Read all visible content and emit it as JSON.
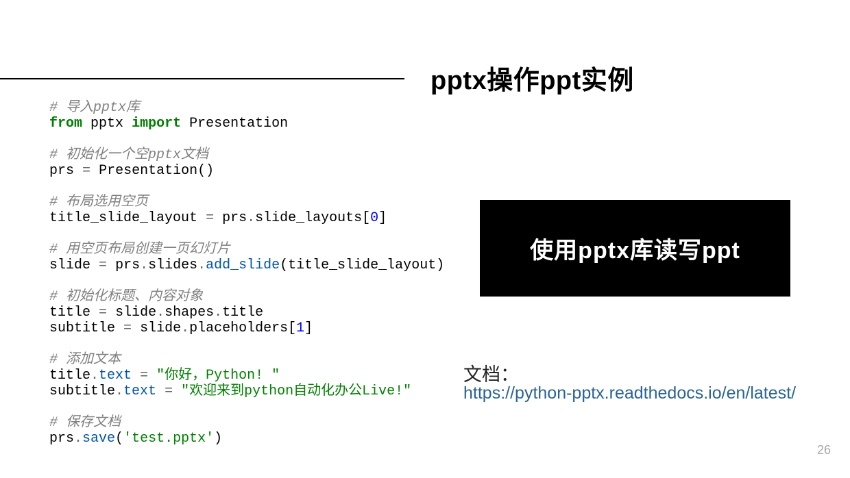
{
  "slide": {
    "title": "pptx操作ppt实例",
    "page_number": "26"
  },
  "code": {
    "c1": "# 导入pptx库",
    "l1a": "from",
    "l1b": "pptx",
    "l1c": "import",
    "l1d": "Presentation",
    "c2": "# 初始化一个空pptx文档",
    "l2a": "prs",
    "l2b": "=",
    "l2c": "Presentation()",
    "c3": "# 布局选用空页",
    "l3a": "title_slide_layout",
    "l3b": "=",
    "l3c": "prs",
    "l3d": ".",
    "l3e": "slide_layouts[",
    "l3f": "0",
    "l3g": "]",
    "c4": "# 用空页布局创建一页幻灯片",
    "l4a": "slide",
    "l4b": "=",
    "l4c": "prs",
    "l4d": ".",
    "l4e": "slides",
    "l4f": ".",
    "l4g": "add_slide",
    "l4h": "(title_slide_layout)",
    "c5": "# 初始化标题、内容对象",
    "l5a": "title",
    "l5b": "=",
    "l5c": "slide",
    "l5d": ".",
    "l5e": "shapes",
    "l5f": ".",
    "l5g": "title",
    "l6a": "subtitle",
    "l6b": "=",
    "l6c": "slide",
    "l6d": ".",
    "l6e": "placeholders[",
    "l6f": "1",
    "l6g": "]",
    "c6": "# 添加文本",
    "l7a": "title",
    "l7b": ".",
    "l7c": "text",
    "l7d": "=",
    "l7e": "\"你好，Python! \"",
    "l8a": "subtitle",
    "l8b": ".",
    "l8c": "text",
    "l8d": "=",
    "l8e": "\"欢迎来到python自动化办公Live!\"",
    "c7": "# 保存文档",
    "l9a": "prs",
    "l9b": ".",
    "l9c": "save",
    "l9d": "(",
    "l9e": "'test.pptx'",
    "l9f": ")"
  },
  "box": {
    "text": "使用pptx库读写ppt"
  },
  "doc": {
    "label": "文档：",
    "url": "https://python-pptx.readthedocs.io/en/latest/"
  }
}
